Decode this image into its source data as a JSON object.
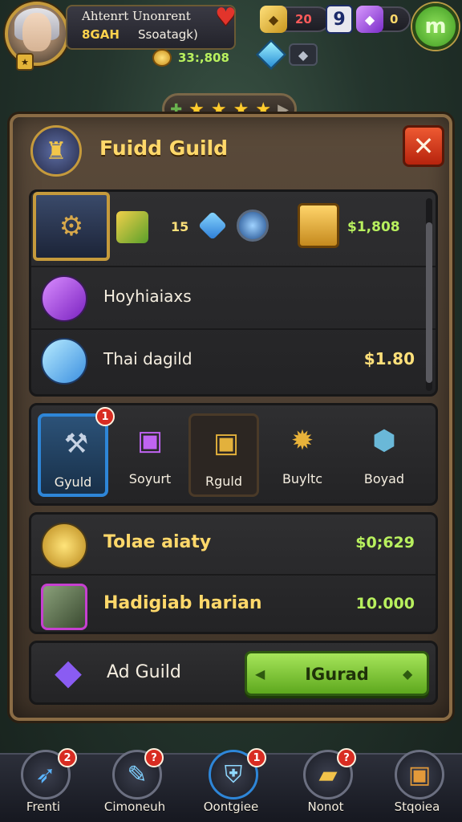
{
  "player": {
    "name": "Ahtenrt Unonrent",
    "power": "8GAH",
    "guild_tag": "Ssoatagk)",
    "gold": "33:,808",
    "level_badge": "★"
  },
  "resources": {
    "red_value": "20",
    "gem_count": "9",
    "purple_value": "0",
    "green_round_label": "m"
  },
  "ribbon": {
    "stars": [
      "★",
      "★",
      "★",
      "★"
    ]
  },
  "panel": {
    "title": "Fuidd Guild",
    "close_glyph": "✕"
  },
  "reward": {
    "count": "15",
    "price": "$1,808"
  },
  "list": [
    {
      "label": "Hoyhiaiaxs",
      "value": ""
    },
    {
      "label": "Thai dagild",
      "value": "$1.80"
    }
  ],
  "categories": [
    {
      "label": "Gyuld",
      "badge": "1"
    },
    {
      "label": "Soyurt",
      "badge": ""
    },
    {
      "label": "Rguld",
      "badge": ""
    },
    {
      "label": "Buyltc",
      "badge": ""
    },
    {
      "label": "Boyad",
      "badge": ""
    }
  ],
  "offers": [
    {
      "label": "Tolae aiaty",
      "value": "$0;629"
    },
    {
      "label": "Hadigiab harian",
      "value": "10.000"
    }
  ],
  "ad": {
    "label": "Ad Guild",
    "button_label": "IGurad"
  },
  "nav": [
    {
      "label": "Frenti",
      "badge": "2"
    },
    {
      "label": "Cimoneuh",
      "badge": "?"
    },
    {
      "label": "Oontgiee",
      "badge": "1"
    },
    {
      "label": "Nonot",
      "badge": "?"
    },
    {
      "label": "Stqoiea",
      "badge": ""
    }
  ],
  "colors": {
    "accent_gold": "#ffd86a",
    "price_green": "#b8f05e",
    "close_red": "#d8351a",
    "button_green": "#7cc63a",
    "active_blue": "#2e86d8"
  }
}
